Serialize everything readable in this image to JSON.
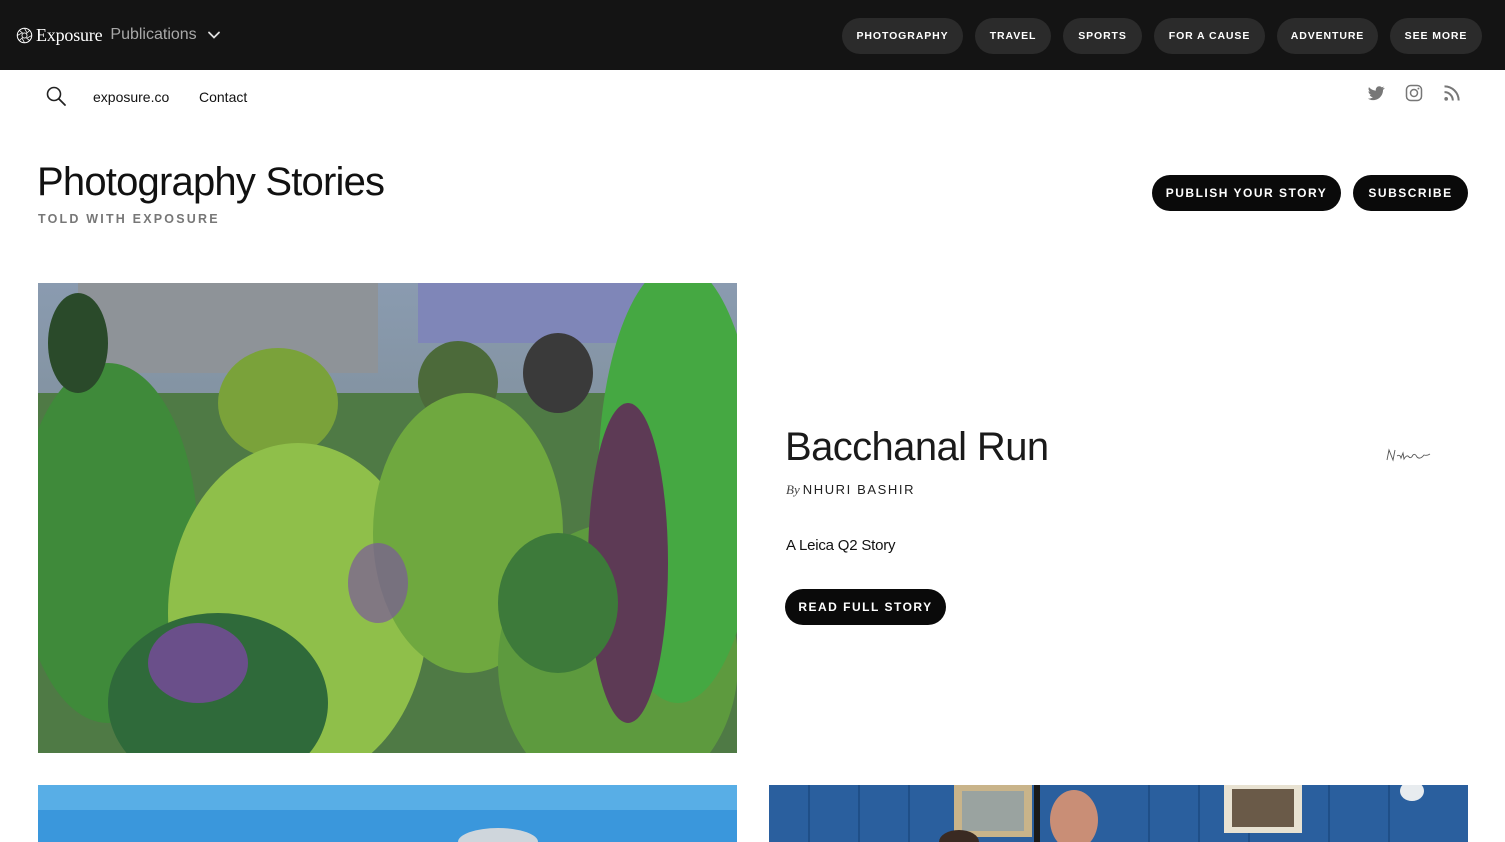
{
  "brand": {
    "name": "Exposure",
    "section": "Publications"
  },
  "nav": {
    "items": [
      "PHOTOGRAPHY",
      "TRAVEL",
      "SPORTS",
      "FOR A CAUSE",
      "ADVENTURE",
      "SEE MORE"
    ]
  },
  "subnav": {
    "site_link": "exposure.co",
    "contact_link": "Contact"
  },
  "social": [
    "twitter-icon",
    "instagram-icon",
    "rss-icon"
  ],
  "header": {
    "title": "Photography Stories",
    "subtitle": "TOLD WITH EXPOSURE",
    "publish_label": "PUBLISH YOUR STORY",
    "subscribe_label": "SUBSCRIBE"
  },
  "featured": {
    "title": "Bacchanal Run",
    "by": "By",
    "author": "NHURI BASHIR",
    "description": "A Leica Q2 Story",
    "cta": "READ FULL STORY"
  },
  "colors": {
    "topbar": "#141414",
    "pill": "#2b2b2b",
    "button": "#0a0a0a",
    "accent_green": "#3aa63a"
  }
}
